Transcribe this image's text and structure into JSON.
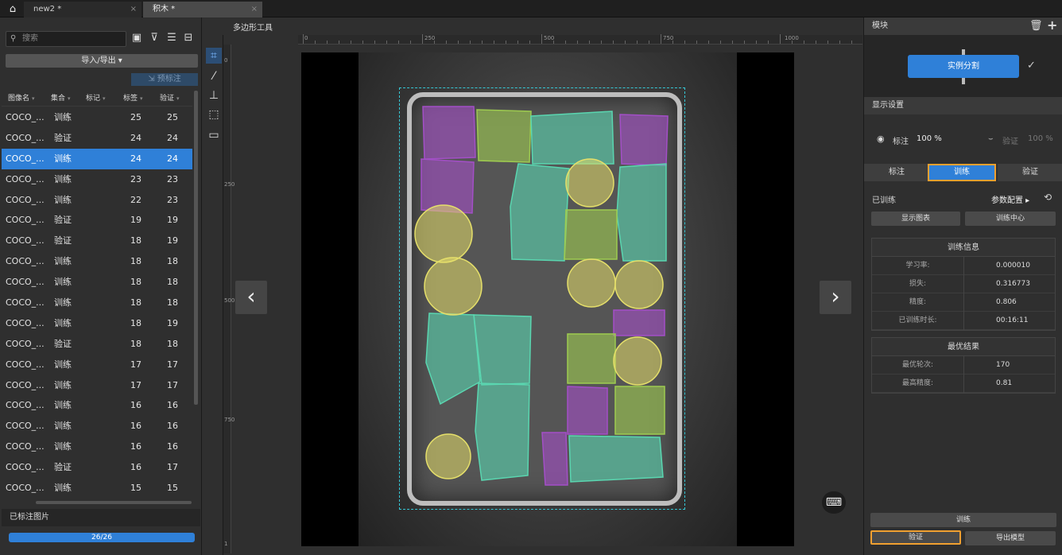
{
  "tabs": [
    {
      "label": "new2 *"
    },
    {
      "label": "积木 *"
    }
  ],
  "left": {
    "search_placeholder": "搜索",
    "import_export": "导入/导出",
    "pre_label": "预标注",
    "columns": [
      "图像名",
      "集合",
      "标记",
      "标签",
      "验证"
    ],
    "rows": [
      {
        "name": "COCO_...",
        "set": "训练",
        "label": "25",
        "verify": "25"
      },
      {
        "name": "COCO_...",
        "set": "验证",
        "label": "24",
        "verify": "24"
      },
      {
        "name": "COCO_...",
        "set": "训练",
        "label": "24",
        "verify": "24"
      },
      {
        "name": "COCO_...",
        "set": "训练",
        "label": "23",
        "verify": "23"
      },
      {
        "name": "COCO_...",
        "set": "训练",
        "label": "22",
        "verify": "23"
      },
      {
        "name": "COCO_...",
        "set": "验证",
        "label": "19",
        "verify": "19"
      },
      {
        "name": "COCO_...",
        "set": "验证",
        "label": "18",
        "verify": "19"
      },
      {
        "name": "COCO_...",
        "set": "训练",
        "label": "18",
        "verify": "18"
      },
      {
        "name": "COCO_...",
        "set": "训练",
        "label": "18",
        "verify": "18"
      },
      {
        "name": "COCO_...",
        "set": "训练",
        "label": "18",
        "verify": "18"
      },
      {
        "name": "COCO_...",
        "set": "训练",
        "label": "18",
        "verify": "19"
      },
      {
        "name": "COCO_...",
        "set": "验证",
        "label": "18",
        "verify": "18"
      },
      {
        "name": "COCO_...",
        "set": "训练",
        "label": "17",
        "verify": "17"
      },
      {
        "name": "COCO_...",
        "set": "训练",
        "label": "17",
        "verify": "17"
      },
      {
        "name": "COCO_...",
        "set": "训练",
        "label": "16",
        "verify": "16"
      },
      {
        "name": "COCO_...",
        "set": "训练",
        "label": "16",
        "verify": "16"
      },
      {
        "name": "COCO_...",
        "set": "训练",
        "label": "16",
        "verify": "16"
      },
      {
        "name": "COCO_...",
        "set": "验证",
        "label": "16",
        "verify": "17"
      },
      {
        "name": "COCO_...",
        "set": "训练",
        "label": "15",
        "verify": "15"
      }
    ],
    "selected_row": 2,
    "labeled_header": "已标注图片",
    "progress_text": "26/26",
    "progress": 1.0
  },
  "center": {
    "header": "多边形工具",
    "ruler_labels": [
      "0",
      "250",
      "500",
      "750",
      "1000"
    ],
    "vruler_labels": [
      "0",
      "250",
      "500",
      "750",
      "1"
    ]
  },
  "right": {
    "module_title": "模块",
    "instance_seg": "实例分割",
    "display_title": "显示设置",
    "annot_label": "标注",
    "annot_value": "100 %",
    "verify_label": "验证",
    "verify_value": "100 %",
    "tab_annot": "标注",
    "tab_train": "训练",
    "tab_verify": "验证",
    "trained": "已训练",
    "param_config": "参数配置",
    "show_chart": "显示图表",
    "train_center": "训练中心",
    "train_info": {
      "title": "训练信息",
      "rows": [
        {
          "k": "学习率:",
          "v": "0.000010"
        },
        {
          "k": "损失:",
          "v": "0.316773"
        },
        {
          "k": "精度:",
          "v": "0.806"
        },
        {
          "k": "已训练时长:",
          "v": "00:16:11"
        }
      ]
    },
    "best": {
      "title": "最优结果",
      "rows": [
        {
          "k": "最优轮次:",
          "v": "170"
        },
        {
          "k": "最高精度:",
          "v": "0.81"
        }
      ]
    },
    "train_btn": "训练",
    "verify_btn": "验证",
    "export_btn": "导出模型"
  },
  "colors": {
    "accent": "#2f80d8",
    "highlight": "#f0a030",
    "purple": "#a34fc7",
    "green": "#9ecb50",
    "teal": "#5ad6b0",
    "yellow": "#e5df6a"
  }
}
